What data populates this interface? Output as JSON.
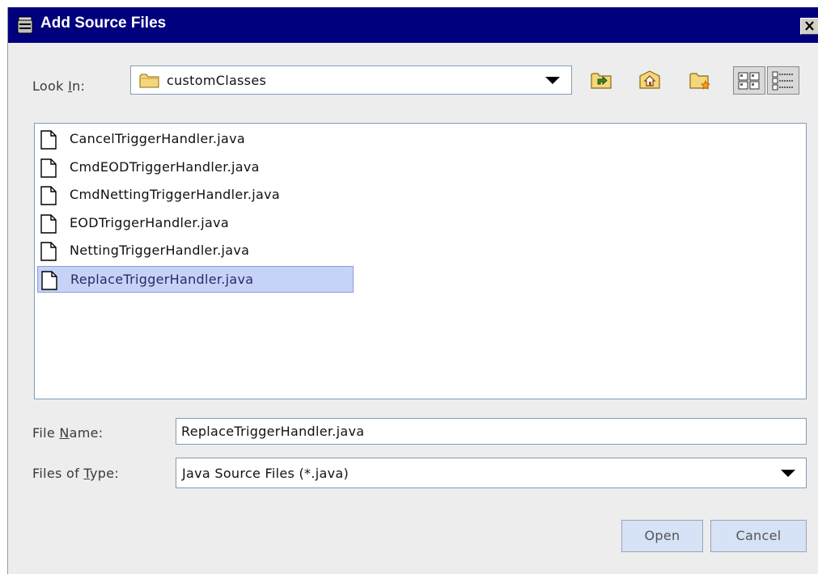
{
  "window": {
    "title": "Add Source Files",
    "title_icon": "jar-icon",
    "close_icon": "close-x-icon"
  },
  "look_in": {
    "label_pre": "Look ",
    "label_mnemonic": "I",
    "label_post": "n:",
    "value": "customClasses",
    "value_icon": "folder-icon"
  },
  "toolbar": [
    {
      "name": "up-one-level-button",
      "icon": "folder-up-icon"
    },
    {
      "name": "home-button",
      "icon": "home-icon"
    },
    {
      "name": "new-folder-button",
      "icon": "new-folder-icon"
    },
    {
      "name": "list-view-button",
      "icon": "list-view-icon"
    },
    {
      "name": "details-view-button",
      "icon": "details-view-icon"
    }
  ],
  "files": [
    {
      "name": "CancelTriggerHandler.java",
      "selected": false
    },
    {
      "name": "CmdEODTriggerHandler.java",
      "selected": false
    },
    {
      "name": "CmdNettingTriggerHandler.java",
      "selected": false
    },
    {
      "name": "EODTriggerHandler.java",
      "selected": false
    },
    {
      "name": "NettingTriggerHandler.java",
      "selected": false
    },
    {
      "name": "ReplaceTriggerHandler.java",
      "selected": true
    }
  ],
  "file_name": {
    "label_pre": "File ",
    "label_mnemonic": "N",
    "label_post": "ame:",
    "value": "ReplaceTriggerHandler.java"
  },
  "file_type": {
    "label_pre": "Files of ",
    "label_mnemonic": "T",
    "label_post": "ype:",
    "value": "Java Source Files (*.java)"
  },
  "buttons": {
    "open": "Open",
    "cancel": "Cancel"
  },
  "colors": {
    "titlebar": "#00007e",
    "selection": "#c6d3f7",
    "button": "#d6e2f5"
  }
}
